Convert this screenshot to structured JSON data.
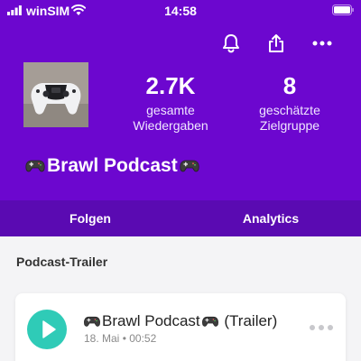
{
  "status_bar": {
    "carrier": "winSIM",
    "time": "14:58"
  },
  "header_icons": [
    "bell-icon",
    "share-icon",
    "more-icon"
  ],
  "podcast": {
    "title": "Brawl Podcast",
    "cover_alt": "white game controller",
    "stats": [
      {
        "value": "2.7K",
        "label_line1": "gesamte",
        "label_line2": "Wiedergaben"
      },
      {
        "value": "8",
        "label_line1": "geschätzte",
        "label_line2": "Zielgruppe"
      }
    ]
  },
  "tabs": [
    {
      "label": "Folgen"
    },
    {
      "label": "Analytics"
    }
  ],
  "section": {
    "title": "Podcast-Trailer"
  },
  "episode": {
    "title": "Brawl Podcast",
    "title_suffix": " (Trailer)",
    "date": "18. Mai",
    "separator": "•",
    "duration": "00:52"
  },
  "colors": {
    "header": "#6c07cf",
    "tabs": "#5a0ab2",
    "play_button": "#2fcbb7",
    "background": "#f4f4f6"
  }
}
